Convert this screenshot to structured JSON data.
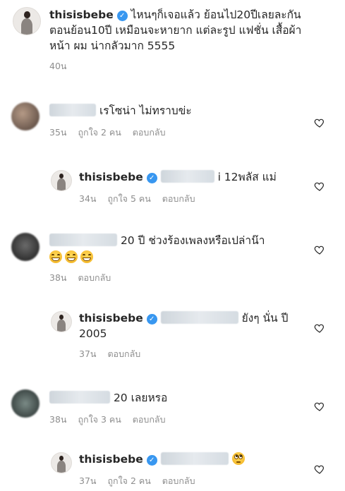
{
  "caption": {
    "username": "thisisbebe",
    "text": "ไหนๆก็เจอแล้ว ย้อนไป20ปีเลยละกัน ตอนย้อน10ปี เหมือนจะหายาก แต่ละรูป แฟชั่น เสื้อผ้า หน้า ผม น่ากลัวมาก 5555",
    "line1": "ไหนๆก็เจอแล้ว ย้อนไป20ปีเลยละกัน",
    "line2": "ตอนย้อน10ปี เหมือนจะหายาก แต่ละรูป แฟชั่น เสื้อผ้า",
    "line3": "หน้า ผม น่ากลัวมาก 5555",
    "time": "40น"
  },
  "comments": [
    {
      "text": "เรโซน่า ไม่ทราบข่ะ",
      "time": "35น",
      "likes": "ถูกใจ 2 คน",
      "reply": "ตอบกลับ",
      "replies": [
        {
          "username": "thisisbebe",
          "text": "i 12พลัส แม่",
          "time": "34น",
          "likes": "ถูกใจ 5 คน",
          "reply": "ตอบกลับ"
        }
      ]
    },
    {
      "text": "20 ปี ช่วงร้องเพลงหรือเปล่าน๊า",
      "time": "38น",
      "reply": "ตอบกลับ",
      "replies": [
        {
          "username": "thisisbebe",
          "text": "ยังๆ นั่น ปี",
          "text2": "2005",
          "time": "37น",
          "reply": "ตอบกลับ"
        }
      ]
    },
    {
      "text": "20 เลยหรอ",
      "time": "38น",
      "likes": "ถูกใจ 3 คน",
      "reply": "ตอบกลับ",
      "replies": [
        {
          "username": "thisisbebe",
          "time": "37น",
          "likes": "ถูกใจ 2 คน",
          "reply": "ตอบกลับ"
        }
      ]
    }
  ],
  "icons": {
    "verified": "verified-badge-icon",
    "like": "heart-outline-icon",
    "emoji_laugh": "grinning-squinting-face-icon",
    "emoji_roll": "face-with-rolling-eyes-icon"
  },
  "colors": {
    "text": "#262626",
    "meta": "#8e8e8e",
    "verified": "#3897f0",
    "background": "#ffffff"
  }
}
